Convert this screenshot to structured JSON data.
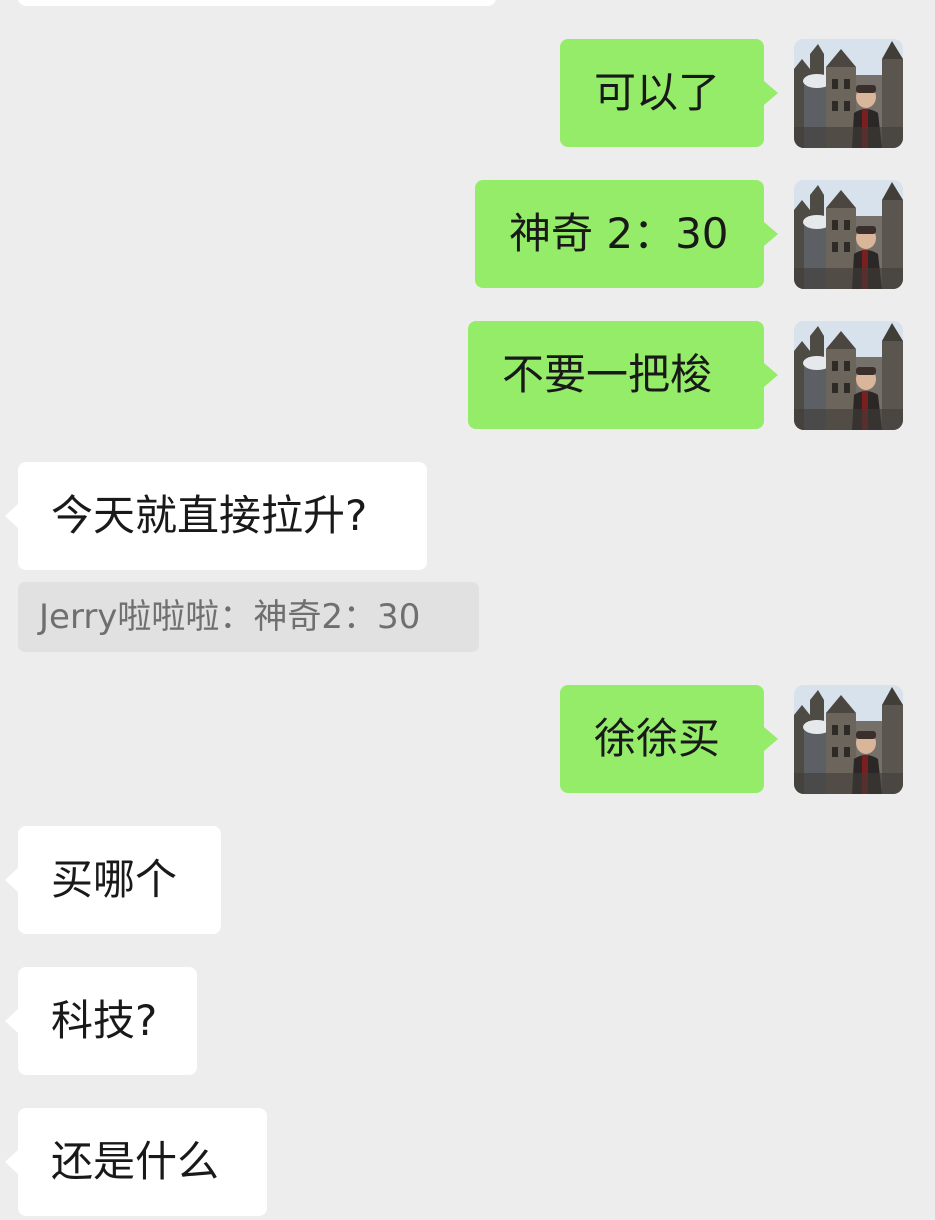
{
  "messages": [
    {
      "direction": "out",
      "text": "可以了"
    },
    {
      "direction": "out",
      "text": "神奇 2：30"
    },
    {
      "direction": "out",
      "text": "不要一把梭"
    },
    {
      "direction": "in",
      "text": "今天就直接拉升?"
    },
    {
      "direction": "out",
      "text": "徐徐买"
    },
    {
      "direction": "in",
      "text": "买哪个"
    },
    {
      "direction": "in",
      "text": "科技?"
    },
    {
      "direction": "in",
      "text": "还是什么"
    }
  ],
  "quote": {
    "text": "Jerry啦啦啦：神奇2：30"
  },
  "colors": {
    "background": "#EDEDED",
    "outgoing_bubble": "#95EC69",
    "incoming_bubble": "#FFFFFF",
    "quote_background": "#E1E1E1",
    "quote_text": "#6F6F6F",
    "message_text": "#191919"
  },
  "icons": {
    "avatar": "user-avatar-photo"
  }
}
